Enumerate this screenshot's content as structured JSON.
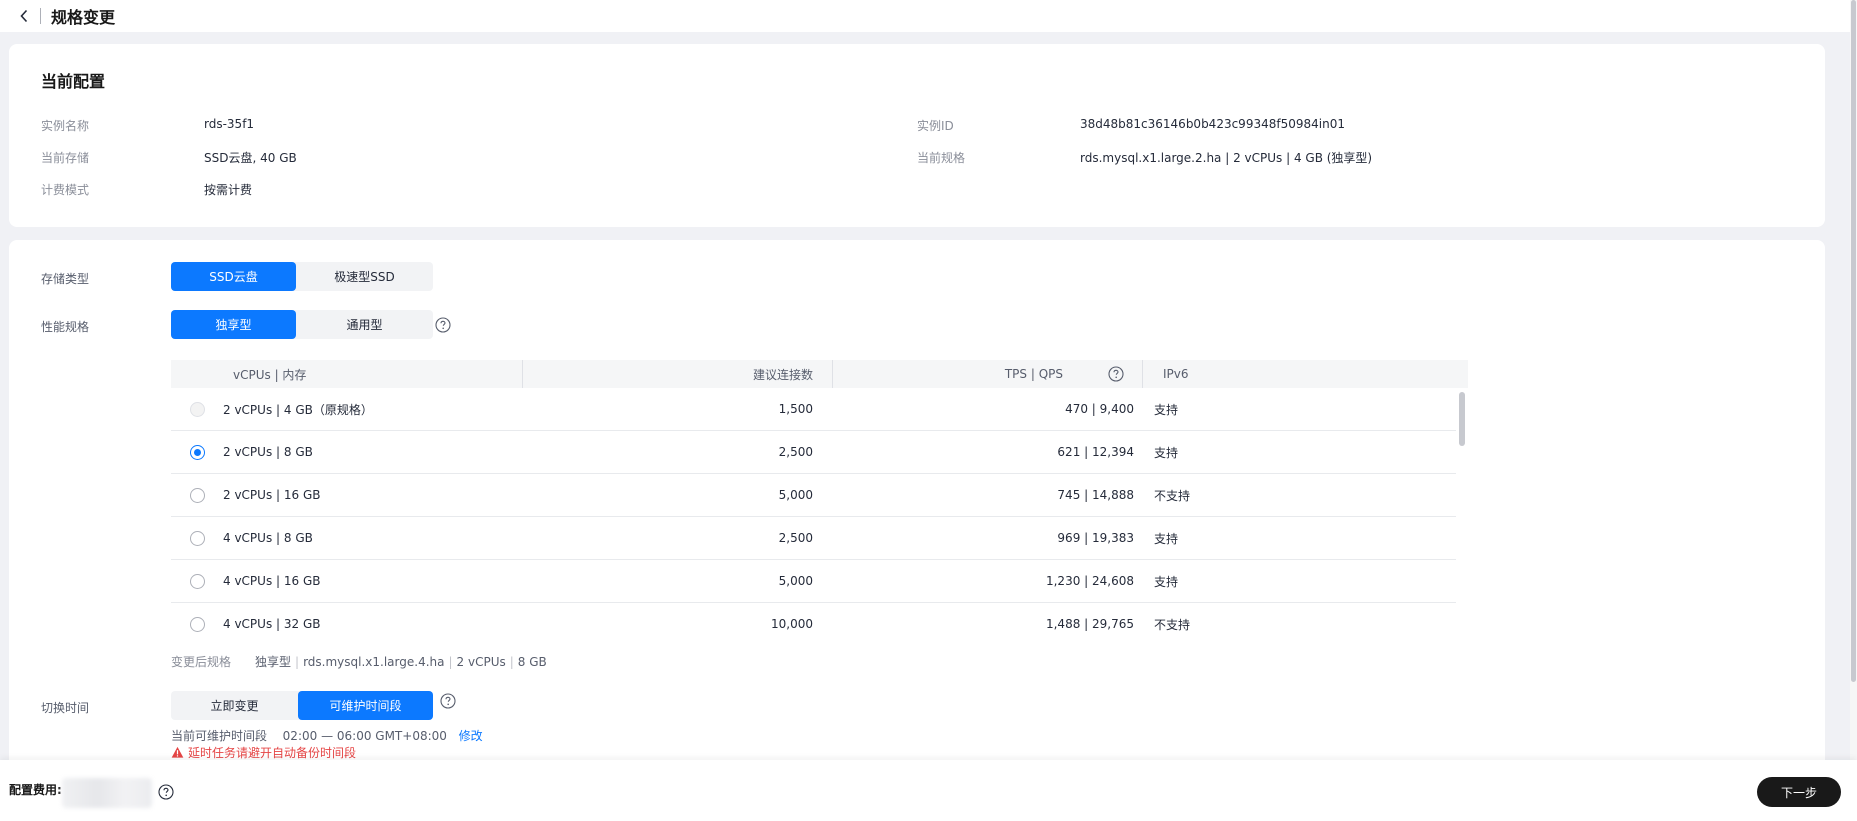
{
  "header": {
    "title": "规格变更"
  },
  "current": {
    "title": "当前配置",
    "left": [
      {
        "k": "实例名称",
        "v": "rds-35f1"
      },
      {
        "k": "当前存储",
        "v": "SSD云盘, 40 GB"
      },
      {
        "k": "计费模式",
        "v": "按需计费"
      }
    ],
    "right": [
      {
        "k": "实例ID",
        "v": "38d48b81c36146b0b423c99348f50984in01"
      },
      {
        "k": "当前规格",
        "v": "rds.mysql.x1.large.2.ha | 2 vCPUs | 4 GB (独享型)"
      }
    ]
  },
  "form": {
    "storage": {
      "label": "存储类型",
      "options": [
        "SSD云盘",
        "极速型SSD"
      ],
      "selected": "SSD云盘"
    },
    "perf": {
      "label": "性能规格",
      "options": [
        "独享型",
        "通用型"
      ],
      "selected": "独享型"
    },
    "table": {
      "headers": [
        "vCPUs | 内存",
        "建议连接数",
        "TPS | QPS",
        "IPv6"
      ],
      "rows": [
        {
          "spec": "2 vCPUs | 4 GB（原规格）",
          "conn": "1,500",
          "tps": "470 | 9,400",
          "ipv6": "支持",
          "state": "disabled"
        },
        {
          "spec": "2 vCPUs | 8 GB",
          "conn": "2,500",
          "tps": "621 | 12,394",
          "ipv6": "支持",
          "state": "checked"
        },
        {
          "spec": "2 vCPUs | 16 GB",
          "conn": "5,000",
          "tps": "745 | 14,888",
          "ipv6": "不支持",
          "state": ""
        },
        {
          "spec": "4 vCPUs | 8 GB",
          "conn": "2,500",
          "tps": "969 | 19,383",
          "ipv6": "支持",
          "state": ""
        },
        {
          "spec": "4 vCPUs | 16 GB",
          "conn": "5,000",
          "tps": "1,230 | 24,608",
          "ipv6": "支持",
          "state": ""
        },
        {
          "spec": "4 vCPUs | 32 GB",
          "conn": "10,000",
          "tps": "1,488 | 29,765",
          "ipv6": "不支持",
          "state": ""
        }
      ]
    },
    "after": {
      "label": "变更后规格",
      "type": "独享型",
      "flavor": "rds.mysql.x1.large.4.ha",
      "cpu": "2 vCPUs",
      "mem": "8 GB"
    },
    "switch": {
      "label": "切换时间",
      "options": [
        "立即变更",
        "可维护时间段"
      ],
      "selected": "可维护时间段"
    },
    "maint": {
      "label": "当前可维护时间段",
      "value": "02:00 — 06:00 GMT+08:00",
      "edit": "修改"
    },
    "warning": "延时任务请避开自动备份时间段"
  },
  "footer": {
    "fee_label": "配置费用:",
    "next": "下一步"
  },
  "colors": {
    "primary": "#0c79ff",
    "warning": "#e54545",
    "dark_button": "#191919"
  }
}
